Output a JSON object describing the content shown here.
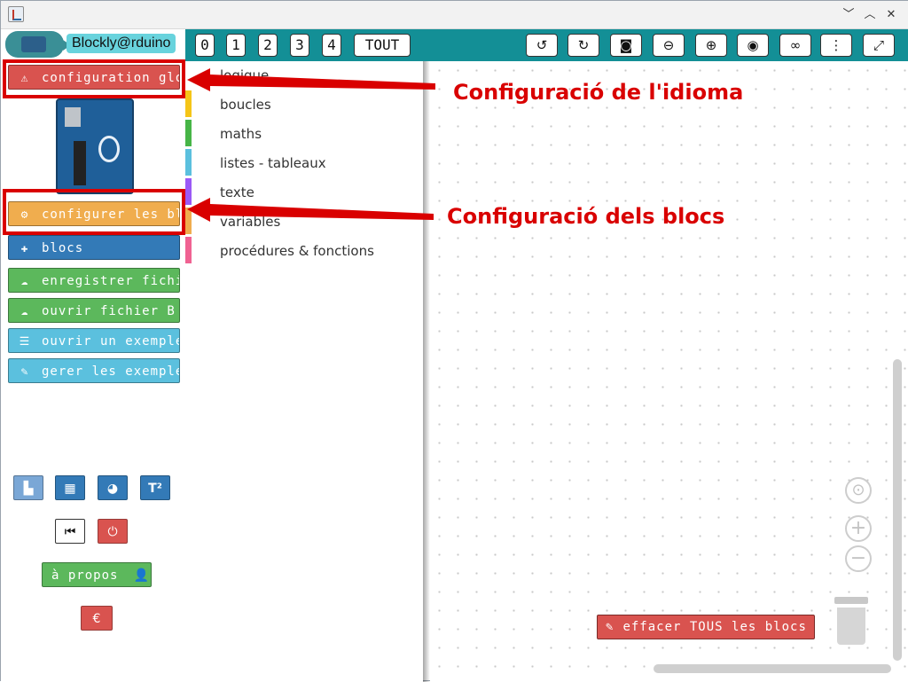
{
  "window": {
    "min": "﹀",
    "max": "︿",
    "close": "✕"
  },
  "logo": {
    "text": "Blockly@rduino"
  },
  "left_buttons": [
    {
      "label": "configuration globa",
      "icon": "warning-icon",
      "glyph": "⚠"
    },
    {
      "label": "configurer les blo",
      "icon": "gears-icon",
      "glyph": "⚙"
    },
    {
      "label": "blocs",
      "icon": "puzzle-icon",
      "glyph": "✚"
    },
    {
      "label": "enregistrer fichier",
      "icon": "cloud-download-icon",
      "glyph": "☁"
    },
    {
      "label": "ouvrir fichier B",
      "icon": "cloud-upload-icon",
      "glyph": "☁"
    },
    {
      "label": "ouvrir un exemple",
      "icon": "list-icon",
      "glyph": "☰"
    },
    {
      "label": "gerer les exemple",
      "icon": "wrench-icon",
      "glyph": "✎"
    }
  ],
  "small_buttons": {
    "factory": "▙",
    "grid": "▦",
    "palette": "◕",
    "text_size": "T²",
    "stop": "⏮",
    "power": "⏻"
  },
  "about": {
    "label": "à propos",
    "glyph": "👤"
  },
  "euro": "€",
  "toolbar": {
    "levels": [
      "0",
      "1",
      "2",
      "3",
      "4"
    ],
    "all": "TOUT",
    "undo": "↺",
    "redo": "↻",
    "camera": "◙",
    "zoom_out": "⊖",
    "zoom_in": "⊕",
    "view": "◉",
    "glasses": "∞",
    "menu": "⋮",
    "fullscreen": "⤢"
  },
  "categories": [
    {
      "label": "logique",
      "color": "#ffffff"
    },
    {
      "label": "boucles",
      "color": "#f5c518"
    },
    {
      "label": "maths",
      "color": "#47b547"
    },
    {
      "label": "listes - tableaux",
      "color": "#5bc0de"
    },
    {
      "label": "texte",
      "color": "#9b59f6"
    },
    {
      "label": "variables",
      "color": "#f0ad4e"
    },
    {
      "label": "procédures & fonctions",
      "color": "#f06292"
    }
  ],
  "workspace": {
    "clear_label": "effacer TOUS les blocs",
    "clear_glyph": "✎",
    "recenter": "⊙",
    "zoom_plus": "+",
    "zoom_minus": "−"
  },
  "annotations": {
    "language": "Configuració de l'idioma",
    "blocks": "Configuració dels blocs"
  },
  "colors": {
    "toolbar": "#138f96",
    "annotation": "#d90000"
  }
}
